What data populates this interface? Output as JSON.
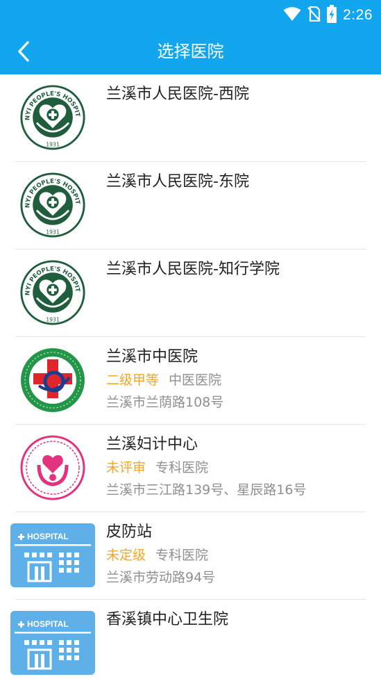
{
  "status": {
    "time": "2:26"
  },
  "header": {
    "title": "选择医院"
  },
  "hospitals": [
    {
      "name": "兰溪市人民医院-西院",
      "level": "",
      "type": "",
      "address": "",
      "logo": "people-hospital-logo",
      "logo_text": "ANYI PEOPLE'S HOSPITAL",
      "logo_year": "1931"
    },
    {
      "name": "兰溪市人民医院-东院",
      "level": "",
      "type": "",
      "address": "",
      "logo": "people-hospital-logo",
      "logo_text": "ANYI PEOPLE'S HOSPITAL",
      "logo_year": "1931"
    },
    {
      "name": "兰溪市人民医院-知行学院",
      "level": "",
      "type": "",
      "address": "",
      "logo": "people-hospital-logo",
      "logo_text": "ANYI PEOPLE'S HOSPITAL",
      "logo_year": "1931"
    },
    {
      "name": "兰溪市中医院",
      "level": "二级甲等",
      "type": "中医医院",
      "address": "兰溪市兰荫路108号",
      "logo": "tcm-hospital-logo"
    },
    {
      "name": "兰溪妇计中心",
      "level": "未评审",
      "type": "专科医院",
      "address": "兰溪市三江路139号、星辰路16号",
      "logo": "maternal-center-logo"
    },
    {
      "name": "皮防站",
      "level": "未定级",
      "type": "专科医院",
      "address": "兰溪市劳动路94号",
      "logo": "hospital-building-icon",
      "logo_text": "HOSPITAL"
    },
    {
      "name": "香溪镇中心卫生院",
      "level": "",
      "type": "",
      "address": "",
      "logo": "hospital-building-icon",
      "logo_text": "HOSPITAL"
    }
  ],
  "colors": {
    "primary": "#12a6ee",
    "level": "#f5a623",
    "secondary_text": "#8f8f8f",
    "logo_green": "#1f5d3d"
  }
}
